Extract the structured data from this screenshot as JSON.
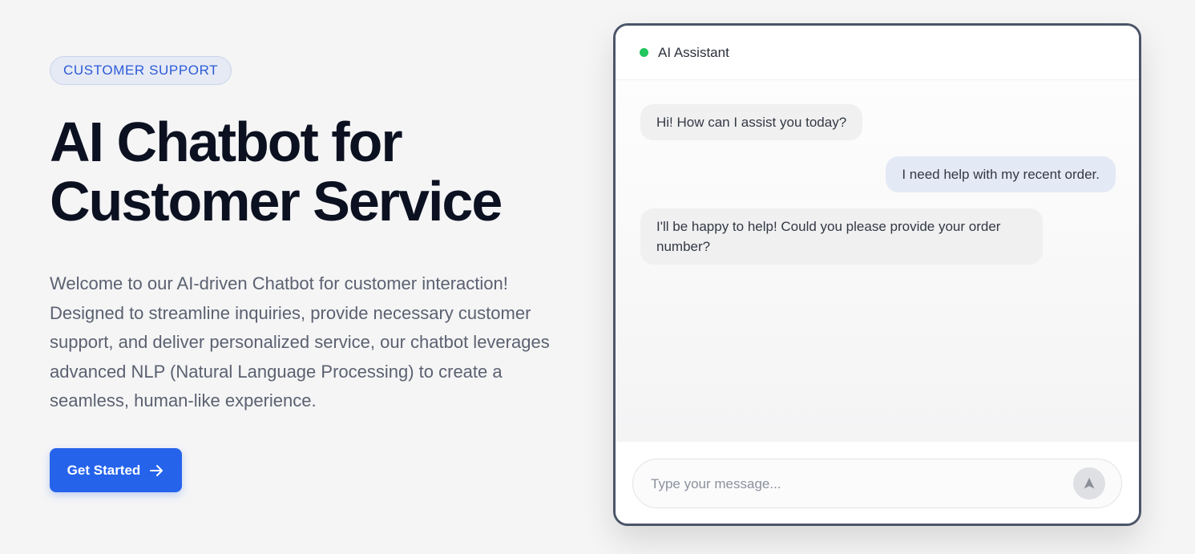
{
  "hero": {
    "badge": "CUSTOMER SUPPORT",
    "title_line1": "AI Chatbot for",
    "title_line2": "Customer Service",
    "description": "Welcome to our AI-driven Chatbot for customer interaction! Designed to streamline inquiries, provide necessary customer support, and deliver personalized service, our chatbot leverages advanced NLP (Natural Language Processing) to create a seamless, human-like experience.",
    "cta_label": "Get Started",
    "cta_icon": "arrow-right-icon"
  },
  "chat": {
    "title": "AI Assistant",
    "status_color": "#22c55e",
    "messages": [
      {
        "role": "assistant",
        "text": "Hi! How can I assist you today?"
      },
      {
        "role": "user",
        "text": "I need help with my recent order."
      },
      {
        "role": "assistant",
        "text": "I'll be happy to help! Could you please provide your order number?"
      }
    ],
    "input_placeholder": "Type your message...",
    "send_icon": "send-icon"
  },
  "colors": {
    "accent": "#2563eb",
    "badge_text": "#2b5bd7",
    "page_background": "#f5f5f6"
  }
}
